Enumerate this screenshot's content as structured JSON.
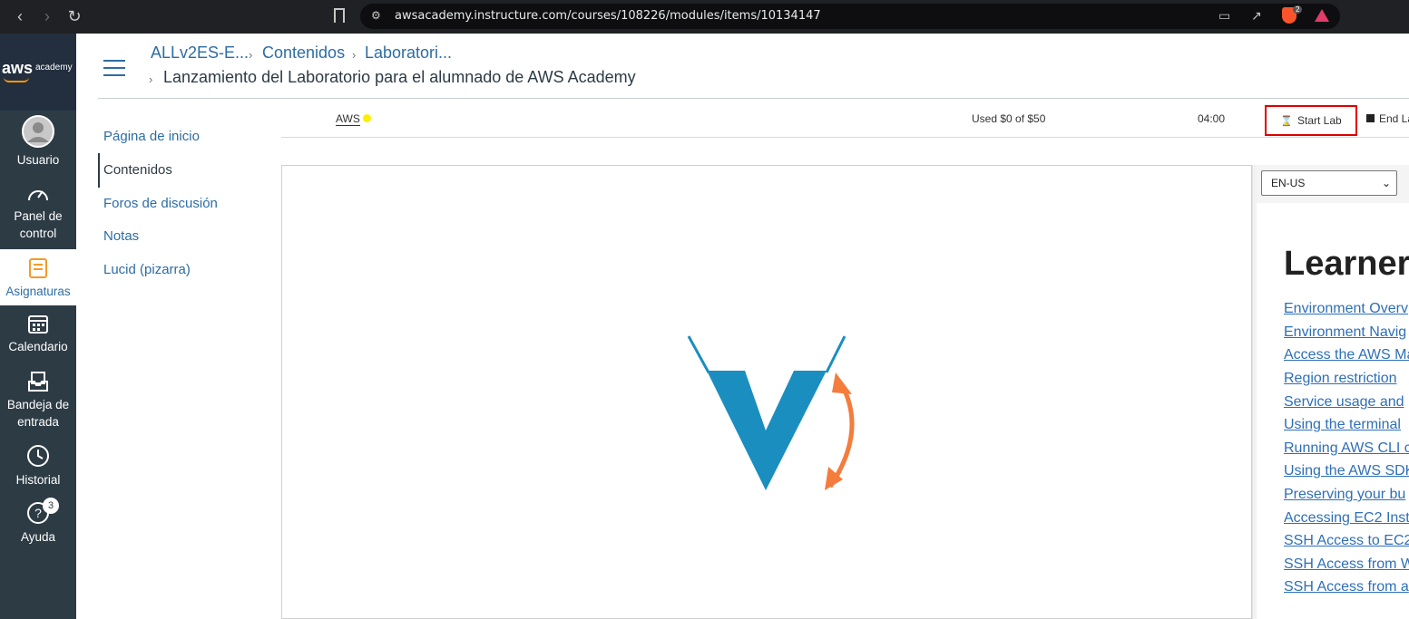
{
  "browser": {
    "url": "awsacademy.instructure.com/courses/108226/modules/items/10134147",
    "extension_badge": "2"
  },
  "logo": {
    "aws": "aws",
    "academy": "academy"
  },
  "global_nav": {
    "items": [
      {
        "label": "Usuario",
        "icon": "user-avatar-icon"
      },
      {
        "label": "Panel de control",
        "icon": "dashboard-icon"
      },
      {
        "label": "Asignaturas",
        "icon": "courses-icon",
        "active": true
      },
      {
        "label": "Calendario",
        "icon": "calendar-icon"
      },
      {
        "label": "Bandeja de entrada",
        "icon": "inbox-icon"
      },
      {
        "label": "Historial",
        "icon": "history-icon"
      },
      {
        "label": "Ayuda",
        "icon": "help-icon",
        "badge": "3"
      }
    ]
  },
  "breadcrumb": {
    "items": [
      "ALLv2ES-E...",
      "Contenidos",
      "Laboratori..."
    ],
    "current": "Lanzamiento del Laboratorio para el alumnado de AWS Academy"
  },
  "course_nav": {
    "items": [
      "Página de inicio",
      "Contenidos",
      "Foros de discusión",
      "Notas",
      "Lucid (pizarra)"
    ],
    "active": "Contenidos"
  },
  "lab_toolbar": {
    "aws_label": "AWS",
    "status_color": "#ffee00",
    "usage": "Used $0 of $50",
    "timer": "04:00",
    "start_label": "Start Lab",
    "end_label": "End La"
  },
  "instructions": {
    "language": "EN-US",
    "heading": "Learner",
    "links": [
      "Environment Overv",
      "Environment Navig",
      "Access the AWS Ma",
      "Region restriction",
      "Service usage and",
      "Using the terminal",
      "Running AWS CLI c",
      "Using the AWS SDK",
      "Preserving your bu",
      "Accessing EC2 Insta",
      "SSH Access to EC2",
      "SSH Access from W",
      "SSH Access from a"
    ]
  },
  "colors": {
    "nav_bg": "#2d3b45",
    "link": "#2d6da3",
    "vocareum_blue": "#1a8ebf",
    "vocareum_orange": "#f47c3c",
    "highlight": "#e00000"
  }
}
